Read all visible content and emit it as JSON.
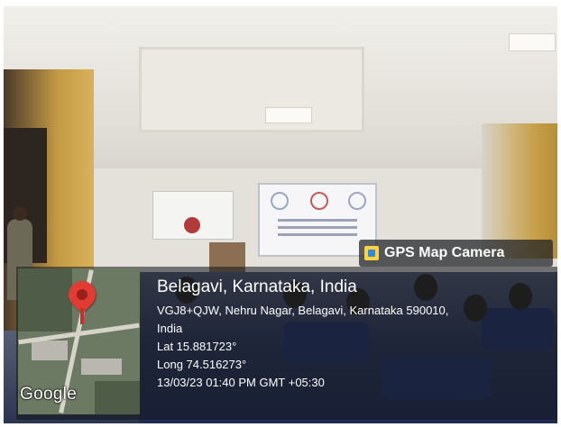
{
  "badge": {
    "label": "GPS Map Camera",
    "icon": "camera-icon"
  },
  "location": {
    "title": "Belagavi, Karnataka, India",
    "address_line1": "VGJ8+QJW, Nehru Nagar, Belagavi, Karnataka 590010,",
    "address_line2": "India",
    "latitude": "Lat 15.881723°",
    "longitude": "Long 74.516273°",
    "datetime": "13/03/23 01:40 PM GMT +05:30"
  },
  "map": {
    "attribution": "Google",
    "pin_color": "#e13b34"
  }
}
